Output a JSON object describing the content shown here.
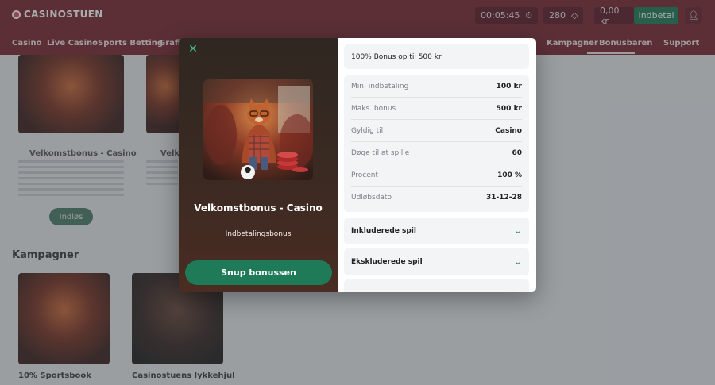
{
  "header": {
    "logo": "CASINOSTUEN",
    "timer": "00:05:45",
    "points": "280",
    "balance": "0,00 kr",
    "deposit_label": "Indbetal"
  },
  "nav": {
    "items": [
      "Casino",
      "Live Casino",
      "Sports Betting",
      "Grafi",
      "Kampagner",
      "Bonusbaren",
      "Support"
    ]
  },
  "background": {
    "card1_title": "Velkomstbonus - Casino",
    "card2_title": "Velko",
    "card_button": "Indløs",
    "section_title": "Kampagner",
    "campaigns": [
      "10% Sportsbook",
      "Casinostuens lykkehjul"
    ]
  },
  "modal": {
    "title": "Velkomstbonus - Casino",
    "subtitle": "Indbetalingsbonus",
    "claim_label": "Snup bonussen",
    "headline": "100% Bonus op til 500 kr",
    "details": [
      {
        "label": "Min. indbetaling",
        "value": "100 kr"
      },
      {
        "label": "Maks. bonus",
        "value": "500 kr"
      },
      {
        "label": "Gyldig til",
        "value": "Casino"
      },
      {
        "label": "Døge til at spille",
        "value": "60"
      },
      {
        "label": "Procent",
        "value": "100 %"
      },
      {
        "label": "Udløbsdato",
        "value": "31-12-28"
      }
    ],
    "accordions": [
      "Inkluderede spil",
      "Ekskluderede spil"
    ]
  },
  "colors": {
    "header_bg": "#7a2a34",
    "accent_green": "#1f7a58"
  }
}
